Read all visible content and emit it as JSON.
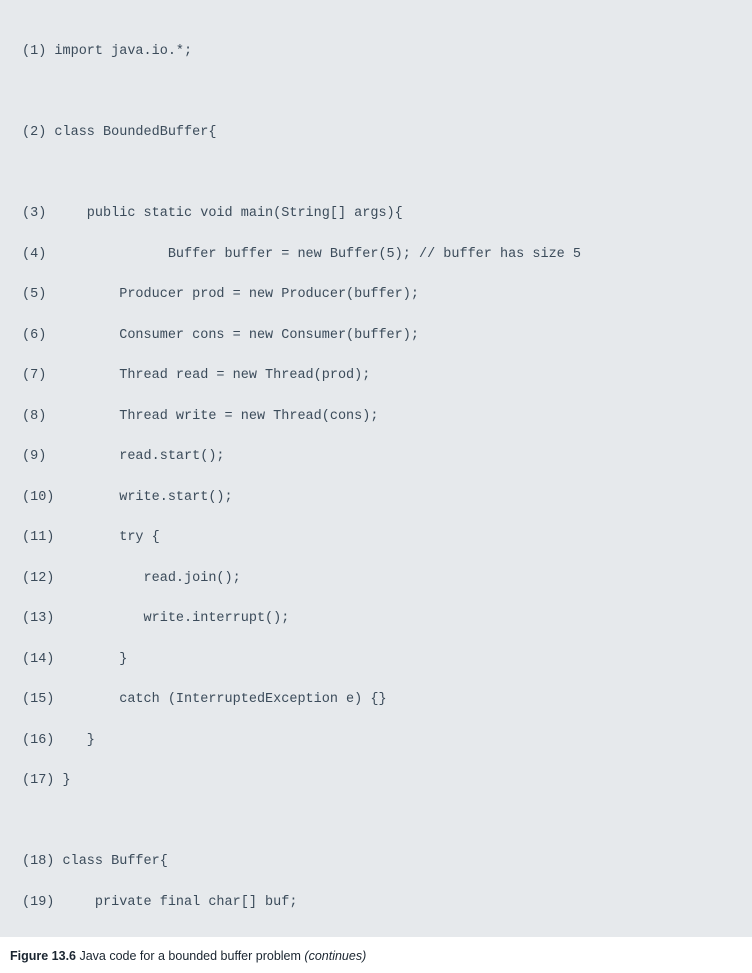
{
  "code": {
    "lines": [
      "(1) import java.io.*;",
      "",
      "(2) class BoundedBuffer{",
      "",
      "(3)     public static void main(String[] args){",
      "(4)               Buffer buffer = new Buffer(5); // buffer has size 5",
      "(5)         Producer prod = new Producer(buffer);",
      "(6)         Consumer cons = new Consumer(buffer);",
      "(7)         Thread read = new Thread(prod);",
      "(8)         Thread write = new Thread(cons);",
      "(9)         read.start();",
      "(10)        write.start();",
      "(11)        try {",
      "(12)           read.join();",
      "(13)           write.interrupt();",
      "(14)        }",
      "(15)        catch (InterruptedException e) {}",
      "(16)    }",
      "(17) }",
      "",
      "(18) class Buffer{",
      "(19)     private final char[] buf;"
    ]
  },
  "caption": {
    "label": "Figure 13.6",
    "text": " Java code for a bounded buffer problem ",
    "cont": "(continues)"
  }
}
